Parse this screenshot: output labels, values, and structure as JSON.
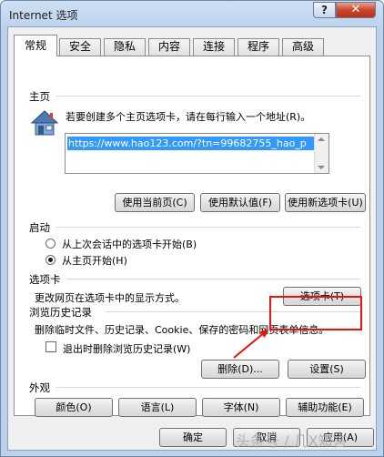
{
  "window": {
    "title": "Internet 选项"
  },
  "titlebar": {
    "help": "?",
    "close": "✕"
  },
  "tabs": [
    "常规",
    "安全",
    "隐私",
    "内容",
    "连接",
    "程序",
    "高级"
  ],
  "homepage": {
    "label": "主页",
    "description": "若要创建多个主页选项卡，请在每行输入一个地址(R)。",
    "url": "https://www.hao123.com/?tn=99682755_hao_p",
    "buttons": {
      "use_current": "使用当前页(C)",
      "use_default": "使用默认值(F)",
      "use_new_tab": "使用新选项卡(U)"
    }
  },
  "startup": {
    "label": "启动",
    "option_last_session": "从上次会话中的选项卡开始(B)",
    "option_homepage": "从主页开始(H)"
  },
  "tabs_section": {
    "label": "选项卡",
    "description": "更改网页在选项卡中的显示方式。",
    "button": "选项卡(T)"
  },
  "history": {
    "label": "浏览历史记录",
    "description": "删除临时文件、历史记录、Cookie、保存的密码和网页表单信息。",
    "checkbox_label": "退出时删除浏览历史记录(W)",
    "delete_button": "删除(D)...",
    "settings_button": "设置(S)"
  },
  "appearance": {
    "label": "外观",
    "buttons": {
      "colors": "颜色(O)",
      "languages": "语言(L)",
      "fonts": "字体(N)",
      "accessibility": "辅助功能(E)"
    }
  },
  "footer": {
    "ok": "确定",
    "cancel": "取消",
    "apply": "应用(A)"
  },
  "watermark": "头条号 / 几X知言",
  "colors": {
    "highlight": "#e8120f",
    "url_selection": "#3399ff"
  }
}
